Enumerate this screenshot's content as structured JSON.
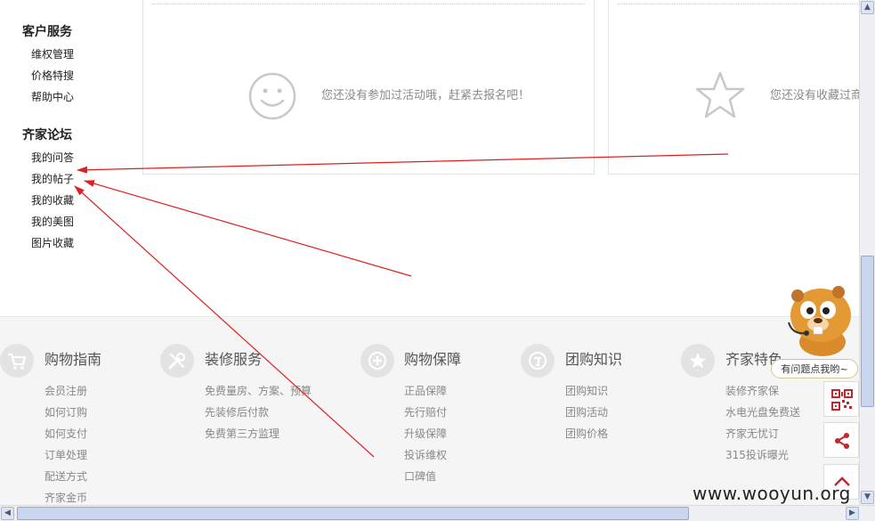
{
  "sidebar": {
    "sections": [
      {
        "title": "客户服务",
        "links": [
          "维权管理",
          "价格特搜",
          "帮助中心"
        ]
      },
      {
        "title": "齐家论坛",
        "links": [
          "我的问答",
          "我的帖子",
          "我的收藏",
          "我的美图",
          "图片收藏"
        ]
      }
    ]
  },
  "panels": {
    "activities_empty": "您还没有参加过活动哦，赶紧去报名吧！",
    "favorites_empty": "您还没有收藏过商"
  },
  "footer": {
    "columns": [
      {
        "title": "购物指南",
        "icon": "cart-icon",
        "links": [
          "会员注册",
          "如何订购",
          "如何支付",
          "订单处理",
          "配送方式",
          "齐家金币"
        ]
      },
      {
        "title": "装修服务",
        "icon": "tools-icon",
        "links": [
          "免费量房、方案、预算",
          "先装修后付款",
          "免费第三方监理"
        ]
      },
      {
        "title": "购物保障",
        "icon": "plus-shield-icon",
        "links": [
          "正品保障",
          "先行赔付",
          "升级保障",
          "投诉维权",
          "口碑值"
        ]
      },
      {
        "title": "团购知识",
        "icon": "group-buy-icon",
        "links": [
          "团购知识",
          "团购活动",
          "团购价格"
        ]
      },
      {
        "title": "齐家特色",
        "icon": "star-badge-icon",
        "links": [
          "装修齐家保",
          "水电光盘免费送",
          "齐家无忧订",
          "315投诉曝光"
        ]
      }
    ]
  },
  "help": {
    "bubble_text": "有问题点我哟~"
  },
  "watermark": "www.wooyun.org",
  "colors": {
    "annotation_arrow": "#e02020",
    "tool_icon_red": "#c0282d",
    "side_badge_green": "#2e8b3a"
  }
}
